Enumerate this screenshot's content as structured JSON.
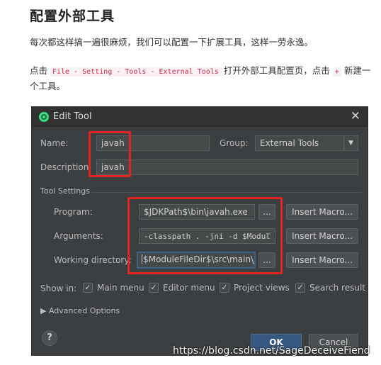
{
  "article": {
    "heading": "配置外部工具",
    "para1": "每次都这样搞一遍很麻烦，我们可以配置一下扩展工具，这样一劳永逸。",
    "para2_prefix": "点击",
    "para2_path": "File - Setting - Tools - External Tools",
    "para2_middle": "打开外部工具配置页，点击",
    "para2_plus": "+",
    "para2_suffix": "新建一个工具。"
  },
  "dialog": {
    "title": "Edit Tool",
    "close_glyph": "✕",
    "name_label": "Name:",
    "name_value": "javah",
    "group_label": "Group:",
    "group_value": "External Tools",
    "description_label": "Description:",
    "description_value": "javah",
    "section_label": "Tool Settings",
    "program_label": "Program:",
    "program_value": "$JDKPath$\\bin\\javah.exe",
    "arguments_label": "Arguments:",
    "arguments_value": "-classpath . -jni -d $Modul",
    "workdir_label": "Working directory:",
    "workdir_value": "$ModuleFileDir$\\src\\main\\J",
    "browse_label": "...",
    "insert_macro_label": "Insert Macro...",
    "show_in_label": "Show in:",
    "show_in": [
      "Main menu",
      "Editor menu",
      "Project views",
      "Search result"
    ],
    "advanced_label": "Advanced Options",
    "help_label": "?",
    "ok_label": "OK",
    "cancel_label": "Cancel"
  },
  "watermark": "https://blog.csdn.net/SageDeceiveFiend",
  "colors": {
    "dialog_bg": "#3c3f41",
    "highlight": "#e52323",
    "ok_button": "#365880",
    "code_text": "#c7254e"
  }
}
